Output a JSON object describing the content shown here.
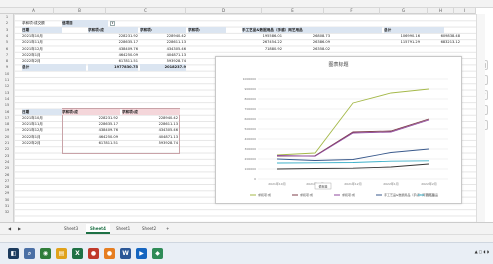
{
  "columns": [
    "A",
    "B",
    "C",
    "D",
    "E",
    "F",
    "G",
    "H",
    "I"
  ],
  "rows": [
    "1",
    "2",
    "3",
    "4",
    "5",
    "6",
    "7",
    "8",
    "9",
    "10",
    "11",
    "12",
    "13",
    "14",
    "15",
    "16",
    "17",
    "18",
    "19",
    "20",
    "21",
    "22",
    "23",
    "24",
    "25",
    "26",
    "27",
    "28",
    "29",
    "30",
    "31",
    "32"
  ],
  "pivot1": {
    "filter_label": "求和项:成交额",
    "filter_value": "值项目",
    "header": [
      "日期",
      "",
      "求和项:成",
      "求和项:",
      "求和项:"
    ],
    "rows": [
      [
        "2021年10月",
        "228231.92",
        "228940.42"
      ],
      [
        "2021年11月",
        "228635.17",
        "228611.13"
      ],
      [
        "2021年12月",
        "438409.76",
        "434305.46"
      ],
      [
        "2022年1月",
        "464250.09",
        "404871.13"
      ],
      [
        "2022年2月",
        "617811.51",
        "593928.74"
      ]
    ],
    "total_label": "总计",
    "total": [
      "1977830.75",
      "2018237.9"
    ]
  },
  "pivot1_right": {
    "header": [
      "手工艺品&数据用品（手感）网艺用品",
      "总计"
    ],
    "rows": [
      [
        "195586.01",
        "26808.73",
        "106990.16",
        "609838.48"
      ],
      [
        "267454.22",
        "26386.09",
        "115791.29",
        "683213.12"
      ],
      [
        "71880.92",
        "26358.02",
        "",
        ""
      ]
    ]
  },
  "pivot2": {
    "header": [
      "日期",
      "求和项:成",
      "求和项:成"
    ],
    "rows": [
      [
        "2021年10月",
        "228231.92",
        "228940.42"
      ],
      [
        "2021年11月",
        "228635.17",
        "228611.13"
      ],
      [
        "2021年12月",
        "438409.76",
        "434305.46"
      ],
      [
        "2022年1月",
        "464250.09",
        "404871.13"
      ],
      [
        "2022年2月",
        "617811.51",
        "593928.74"
      ]
    ]
  },
  "chart_data": {
    "type": "line",
    "title": "图表标题",
    "categories": [
      "2021年10月",
      "2021年11月",
      "2021年12月",
      "2022年1月",
      "2022年2月"
    ],
    "ylim": [
      0,
      1000000
    ],
    "yticks": [
      "1000000",
      "900000",
      "800000",
      "700000",
      "600000",
      "500000",
      "400000",
      "300000",
      "200000",
      "100000",
      "0"
    ],
    "series": [
      {
        "name": "",
        "color": "#a5b94a",
        "values": [
          240000,
          260000,
          760000,
          860000,
          900000
        ]
      },
      {
        "name": "",
        "color": "#7d3c4a",
        "values": [
          230000,
          232000,
          470000,
          480000,
          600000
        ]
      },
      {
        "name": "",
        "color": "#8f4a9e",
        "values": [
          235000,
          228000,
          460000,
          470000,
          590000
        ]
      },
      {
        "name": "",
        "color": "#3a5a8c",
        "values": [
          200000,
          185000,
          195000,
          265000,
          300000
        ]
      },
      {
        "name": "",
        "color": "#3bb0c9",
        "values": [
          160000,
          162000,
          165000,
          178000,
          182000
        ]
      },
      {
        "name": "",
        "color": "#333333",
        "values": [
          100000,
          105000,
          108000,
          120000,
          150000
        ]
      }
    ],
    "legend": [
      "求和项:成",
      "求和项:成",
      "求和项:成",
      "手工艺品&数据用品（手感）网艺用品",
      "网艺用品"
    ],
    "tooltip": "值标签"
  },
  "sheets": [
    "Sheet3",
    "Sheet4",
    "Sheet1",
    "Sheet2"
  ],
  "active_sheet": "Sheet4",
  "add_sheet": "+",
  "side_tools": [
    "table-icon",
    "brush-icon",
    "filter-icon",
    "gear-icon",
    "pin-icon"
  ],
  "taskbar_icons": [
    {
      "name": "start-icon",
      "glyph": "◧",
      "color": "#1c3b5e"
    },
    {
      "name": "search-icon",
      "glyph": "⌕",
      "color": "#4a6fa5"
    },
    {
      "name": "browser-icon",
      "glyph": "◉",
      "color": "#2f7d3a"
    },
    {
      "name": "folder-icon",
      "glyph": "▤",
      "color": "#e0a21b"
    },
    {
      "name": "excel-icon",
      "glyph": "X",
      "color": "#1e7145"
    },
    {
      "name": "app-red-icon",
      "glyph": "●",
      "color": "#c0392b"
    },
    {
      "name": "app-orange-icon",
      "glyph": "●",
      "color": "#e67e22"
    },
    {
      "name": "wps-icon",
      "glyph": "W",
      "color": "#2b5797"
    },
    {
      "name": "media-icon",
      "glyph": "▶",
      "color": "#1565c0"
    },
    {
      "name": "chat-icon",
      "glyph": "◆",
      "color": "#2e8b57"
    }
  ]
}
